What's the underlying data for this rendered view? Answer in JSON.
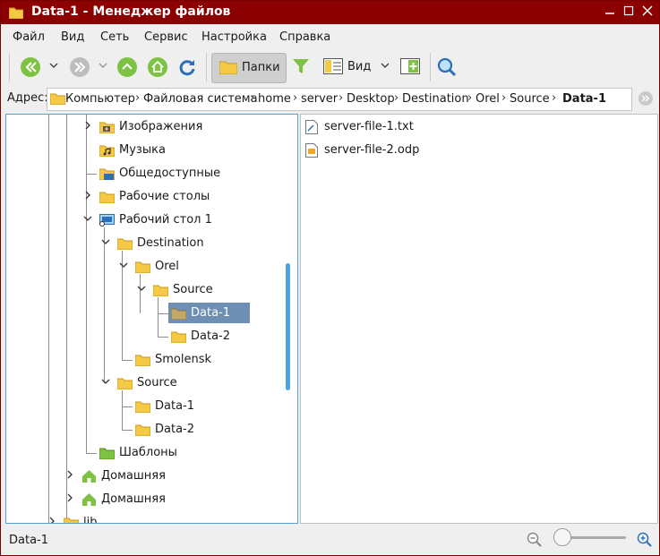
{
  "window": {
    "title": "Data-1 - Менеджер файлов",
    "accent_color": "#8b0000"
  },
  "menubar": {
    "items": [
      "Файл",
      "Вид",
      "Сеть",
      "Сервис",
      "Настройка",
      "Справка"
    ]
  },
  "toolbar": {
    "back_icon": "back-icon",
    "forward_icon": "forward-icon",
    "up_icon": "up-icon",
    "home_icon": "home-icon",
    "refresh_icon": "refresh-icon",
    "folders_label": "Папки",
    "filter_icon": "filter-icon",
    "view_label": "Вид",
    "search_icon": "search-icon"
  },
  "address": {
    "label": "Адрес:",
    "crumbs": [
      "Компьютер",
      "Файловая система",
      "home",
      "server",
      "Desktop",
      "Destination",
      "Orel",
      "Source",
      "Data-1"
    ]
  },
  "tree": {
    "nodes": [
      {
        "label": "Изображения",
        "icon": "pictures-folder-icon"
      },
      {
        "label": "Музыка",
        "icon": "music-folder-icon"
      },
      {
        "label": "Общедоступные",
        "icon": "public-folder-icon"
      },
      {
        "label": "Рабочие столы",
        "icon": "folder-icon"
      },
      {
        "label": "Рабочий стол 1",
        "icon": "desktop-icon"
      },
      {
        "label": "Destination",
        "icon": "folder-icon"
      },
      {
        "label": "Orel",
        "icon": "folder-icon"
      },
      {
        "label": "Source",
        "icon": "folder-icon"
      },
      {
        "label": "Data-1",
        "icon": "folder-icon",
        "selected": true
      },
      {
        "label": "Data-2",
        "icon": "folder-icon"
      },
      {
        "label": "Smolensk",
        "icon": "folder-icon"
      },
      {
        "label": "Source",
        "icon": "folder-icon"
      },
      {
        "label": "Data-1",
        "icon": "folder-icon"
      },
      {
        "label": "Data-2",
        "icon": "folder-icon"
      },
      {
        "label": "Шаблоны",
        "icon": "templates-folder-icon"
      },
      {
        "label": "Домашняя",
        "icon": "home-folder-icon"
      },
      {
        "label": "Домашняя",
        "icon": "home-folder-icon"
      },
      {
        "label": "lib",
        "icon": "folder-icon"
      }
    ]
  },
  "files": [
    {
      "name": "server-file-1.txt",
      "icon": "text-file-icon"
    },
    {
      "name": "server-file-2.odp",
      "icon": "presentation-file-icon"
    }
  ],
  "status": {
    "text": "Data-1",
    "zoom_out_icon": "zoom-out-icon",
    "zoom_in_icon": "zoom-in-icon",
    "zoom_level": 0
  }
}
